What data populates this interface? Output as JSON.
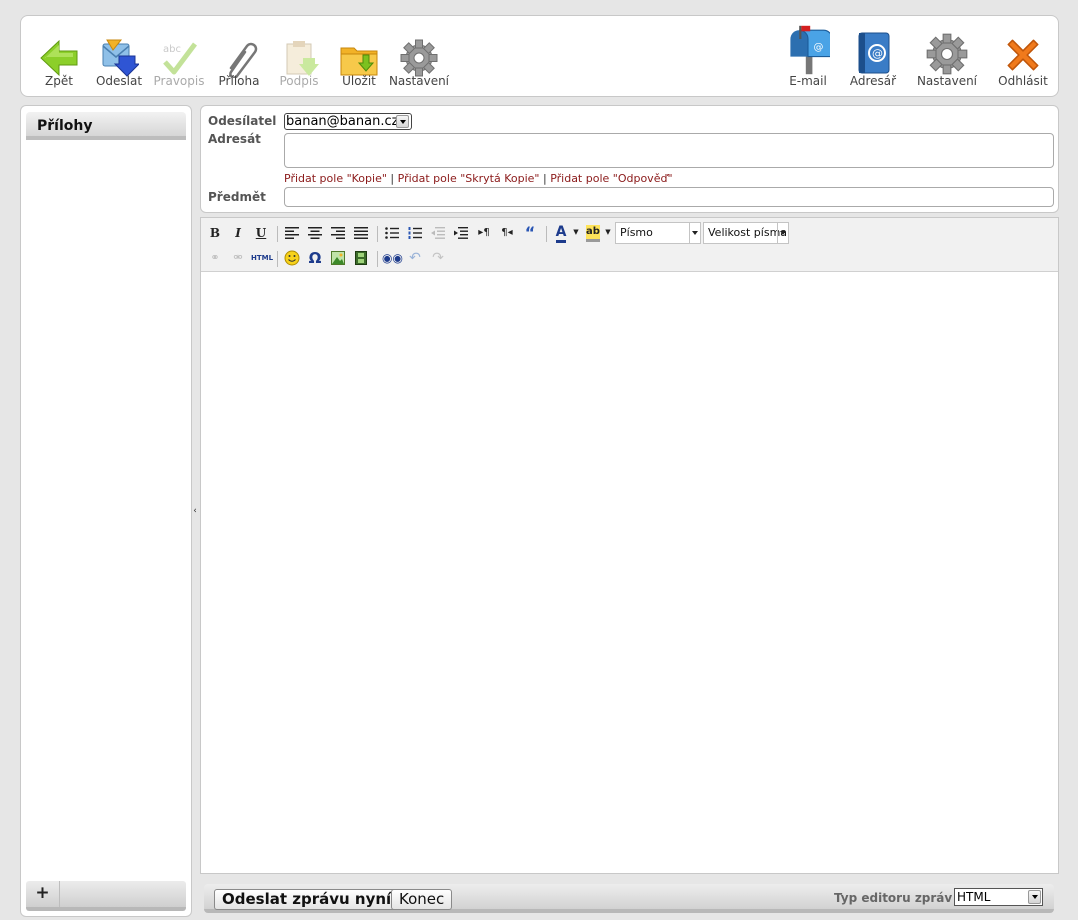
{
  "toolbar": {
    "left": [
      {
        "label": "Zpět",
        "icon": "back-arrow-icon"
      },
      {
        "label": "Odeslat",
        "icon": "send-icon"
      },
      {
        "label": "Pravopis",
        "icon": "spellcheck-icon",
        "disabled": true
      },
      {
        "label": "Příloha",
        "icon": "paperclip-icon"
      },
      {
        "label": "Podpis",
        "icon": "signature-icon",
        "disabled": true
      },
      {
        "label": "Uložit",
        "icon": "save-folder-icon"
      },
      {
        "label": "Nastavení",
        "icon": "gear-icon"
      }
    ],
    "right": [
      {
        "label": "E-mail",
        "icon": "mailbox-icon"
      },
      {
        "label": "Adresář",
        "icon": "address-book-icon"
      },
      {
        "label": "Nastavení",
        "icon": "gear-icon"
      },
      {
        "label": "Odhlásit",
        "icon": "logout-x-icon"
      }
    ]
  },
  "attachments": {
    "title": "Přílohy",
    "add_label": "+"
  },
  "form": {
    "sender_label": "Odesílatel",
    "sender_value": "banan@banan.cz",
    "to_label": "Adresát",
    "to_value": "",
    "add_cc": "Přidat pole \"Kopie\"",
    "add_bcc": "Přidat pole \"Skrytá Kopie\"",
    "add_reply": "Přidat pole \"Odpověď\"",
    "separator": "|",
    "subject_label": "Předmět",
    "subject_value": ""
  },
  "editor": {
    "font_select": "Písmo",
    "size_select": "Velikost písma",
    "row1": [
      "B",
      "I",
      "U"
    ],
    "body": ""
  },
  "bottom": {
    "send_now": "Odeslat zprávu nyní",
    "close": "Konec",
    "editor_type_label": "Typ editoru zpráv",
    "editor_type_value": "HTML"
  },
  "colors": {
    "link": "#8b1a1a",
    "accent_green": "#7cc11f",
    "accent_orange": "#f07a1c"
  }
}
